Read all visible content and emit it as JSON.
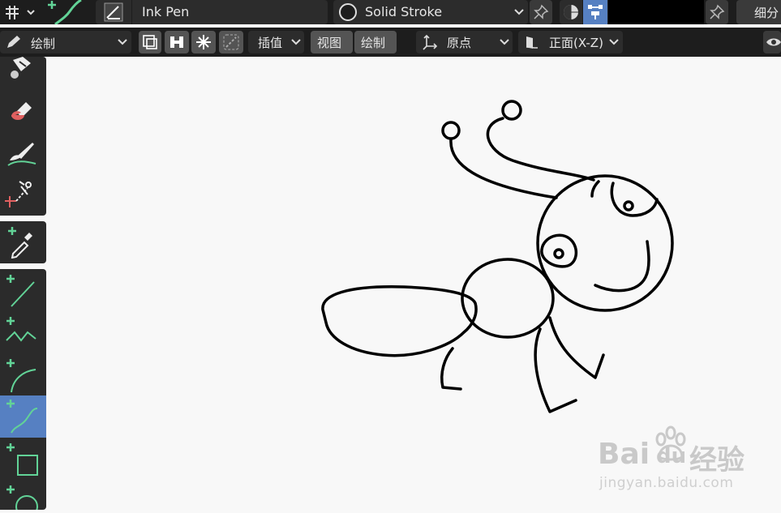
{
  "header": {
    "brush_name": "Ink Pen",
    "material_name": "Solid Stroke",
    "subdivide_label": "细分"
  },
  "toolbar": {
    "mode_label": "绘制",
    "interpolate_label": "插值",
    "view_label": "视图",
    "draw_label": "绘制",
    "origin_label": "原点",
    "orientation_label": "正面(X-Z)"
  },
  "tools": [
    {
      "name": "fill-tool",
      "icon": "fill-bucket-icon"
    },
    {
      "name": "erase-tool",
      "icon": "eraser-icon"
    },
    {
      "name": "tint-tool",
      "icon": "brush-icon"
    },
    {
      "name": "cutter-tool",
      "icon": "scissors-icon"
    },
    {
      "name": "eyedropper-tool",
      "icon": "eyedropper-icon"
    },
    {
      "name": "line-tool",
      "icon": "line-icon"
    },
    {
      "name": "polyline-tool",
      "icon": "polyline-icon"
    },
    {
      "name": "arc-tool",
      "icon": "arc-icon"
    },
    {
      "name": "curve-tool",
      "icon": "curve-icon",
      "active": true
    },
    {
      "name": "box-tool",
      "icon": "box-icon"
    },
    {
      "name": "circle-tool",
      "icon": "circle-icon"
    }
  ],
  "colors": {
    "active_tool": "#5680c2",
    "accent_green": "#62d397",
    "canvas_bg": "#f8f8f8",
    "panel_bg": "#2b2b2b"
  },
  "watermark": {
    "brand_latin": "Bai",
    "brand_du": "du",
    "brand_cn": "经验",
    "url": "jingyan.baidu.com"
  }
}
